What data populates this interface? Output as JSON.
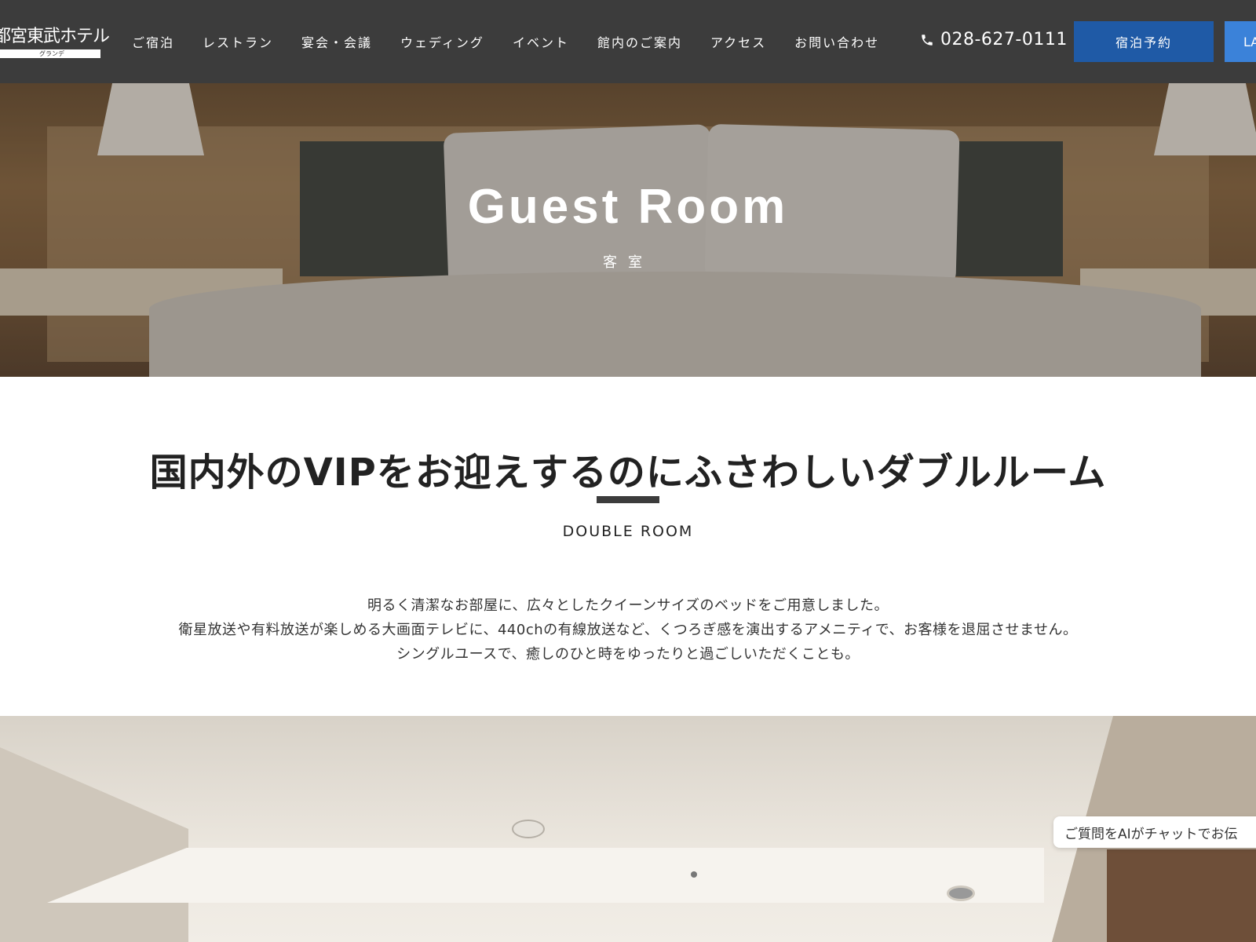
{
  "header": {
    "logo_main": "都宮東武ホテル",
    "logo_sub": "グランデ",
    "nav": [
      "ご宿泊",
      "レストラン",
      "宴会・会議",
      "ウェディング",
      "イベント",
      "館内のご案内",
      "アクセス",
      "お問い合わせ"
    ],
    "phone": "028-627-0111",
    "reserve_label": "宿泊予約",
    "lang_label": "LA"
  },
  "hero": {
    "title": "Guest Room",
    "subtitle": "客室"
  },
  "section": {
    "heading": "国内外のVIPをお迎えするのにふさわしいダブルルーム",
    "subheading": "DOUBLE ROOM",
    "description": [
      "明るく清潔なお部屋に、広々としたクイーンサイズのベッドをご用意しました。",
      "衛星放送や有料放送が楽しめる大画面テレビに、440chの有線放送など、くつろぎ感を演出するアメニティで、お客様を退屈させません。",
      "シングルユースで、癒しのひと時をゆったりと過ごしいただくことも。"
    ]
  },
  "chat": {
    "label": "ご質問をAIがチャットでお伝"
  },
  "colors": {
    "header_bg": "#3c3c3c",
    "reserve_btn": "#1f5aa6",
    "lang_btn": "#3b82d9",
    "heading_bar": "#3c3c3c"
  }
}
